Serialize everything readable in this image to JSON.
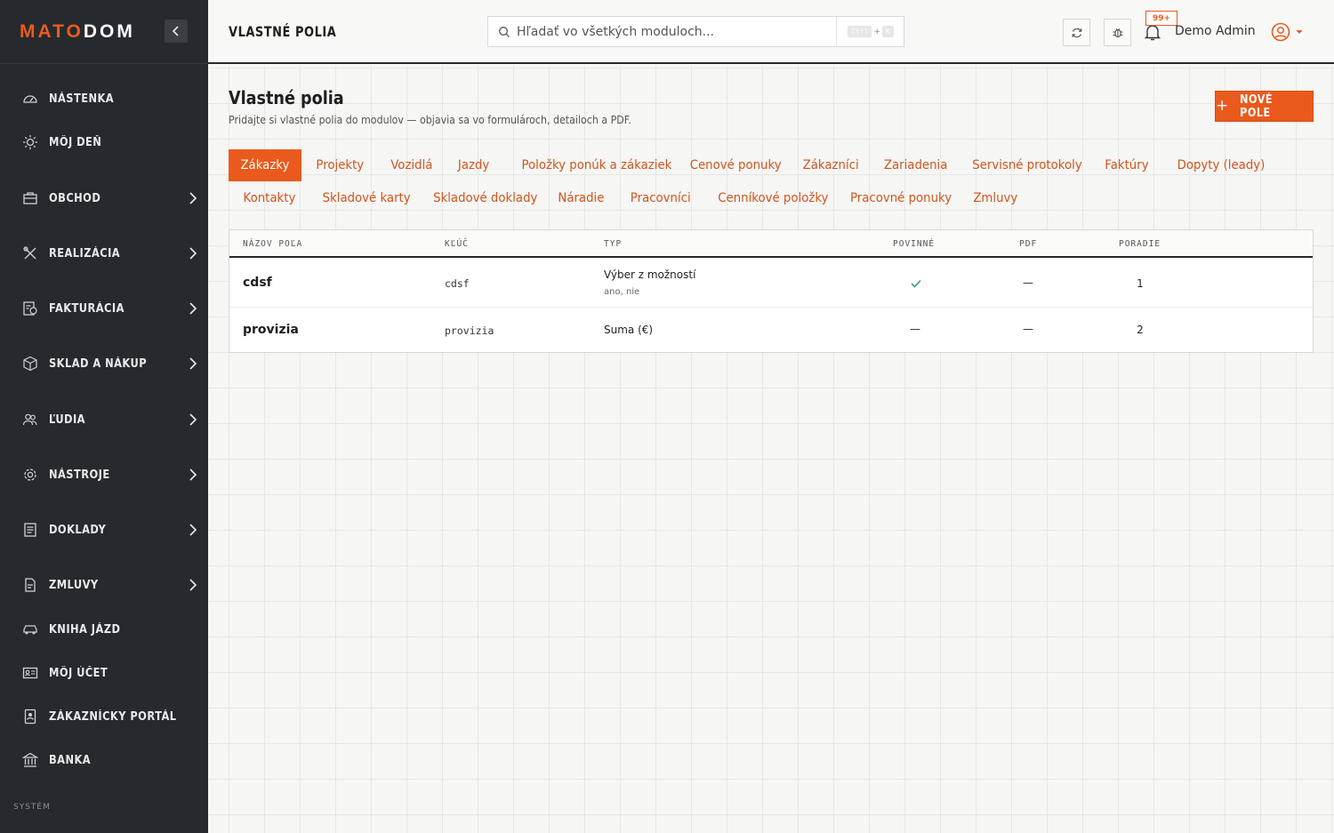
{
  "brand": {
    "logo_a": "MATO",
    "logo_b": "DOM"
  },
  "sidebar": {
    "items": [
      {
        "label": "NÁSTENKA",
        "icon": "dashboard-icon",
        "has_children": false
      },
      {
        "label": "MÔJ DEŇ",
        "icon": "sun-icon",
        "has_children": false
      },
      {
        "label": "OBCHOD",
        "icon": "briefcase-icon",
        "has_children": true
      },
      {
        "label": "REALIZÁCIA",
        "icon": "tools-icon",
        "has_children": true
      },
      {
        "label": "FAKTURÁCIA",
        "icon": "invoice-icon",
        "has_children": true
      },
      {
        "label": "SKLAD A NÁKUP",
        "icon": "box-icon",
        "has_children": true
      },
      {
        "label": "ĽUDIA",
        "icon": "people-icon",
        "has_children": true
      },
      {
        "label": "NÁSTROJE",
        "icon": "gear-icon",
        "has_children": true
      },
      {
        "label": "DOKLADY",
        "icon": "document-icon",
        "has_children": true
      },
      {
        "label": "ZMLUVY",
        "icon": "contract-icon",
        "has_children": true
      },
      {
        "label": "KNIHA JÁZD",
        "icon": "car-icon",
        "has_children": false
      },
      {
        "label": "MÔJ ÚČET",
        "icon": "id-card-icon",
        "has_children": false
      },
      {
        "label": "ZÁKAZNÍCKY PORTÁL",
        "icon": "portal-icon",
        "has_children": false
      },
      {
        "label": "BANKA",
        "icon": "bank-icon",
        "has_children": false
      }
    ],
    "section_label": "SYSTÉM"
  },
  "topbar": {
    "page_heading": "VLASTNÉ POLIA",
    "search_placeholder": "Hľadať vo všetkých moduloch...",
    "kbd_ctrl": "Ctrl",
    "kbd_plus": "+",
    "kbd_key": "K",
    "notifications_badge": "99+",
    "user_name": "Demo Admin"
  },
  "main": {
    "title": "Vlastné polia",
    "subtitle": "Pridajte si vlastné polia do modulov — objavia sa vo formulároch, detailoch a PDF.",
    "new_button_icon": "+",
    "new_button_label": "NOVÉ POLE",
    "tabs": [
      {
        "label": "Zákazky",
        "active": true
      },
      {
        "label": "Projekty"
      },
      {
        "label": "Vozidlá"
      },
      {
        "label": "Jazdy"
      },
      {
        "label": "Položky ponúk a zákaziek"
      },
      {
        "label": "Cenové ponuky"
      },
      {
        "label": "Zákazníci"
      },
      {
        "label": "Zariadenia"
      },
      {
        "label": "Servisné protokoly"
      },
      {
        "label": "Faktúry"
      },
      {
        "label": "Dopyty (leady)"
      },
      {
        "label": "Kontakty"
      },
      {
        "label": "Skladové karty"
      },
      {
        "label": "Skladové doklady"
      },
      {
        "label": "Náradie"
      },
      {
        "label": "Pracovníci"
      },
      {
        "label": "Cenníkové položky"
      },
      {
        "label": "Pracovné ponuky"
      },
      {
        "label": "Zmluvy"
      }
    ],
    "table": {
      "columns": [
        "NÁZOV POĽA",
        "KĽÚČ",
        "TYP",
        "POVINNÉ",
        "PDF",
        "PORADIE"
      ],
      "rows": [
        {
          "name": "cdsf",
          "key": "cdsf",
          "type": "Výber z možností",
          "type_options": "ano, nie",
          "required": true,
          "required_text": "",
          "pdf": "—",
          "order": "1"
        },
        {
          "name": "provizia",
          "key": "provizia",
          "type": "Suma (€)",
          "type_options": "",
          "required": false,
          "required_text": "—",
          "pdf": "—",
          "order": "2"
        }
      ]
    }
  },
  "colors": {
    "accent": "#ea5a1c",
    "sidebar_bg": "#26292e",
    "check": "#2e9e5b"
  }
}
